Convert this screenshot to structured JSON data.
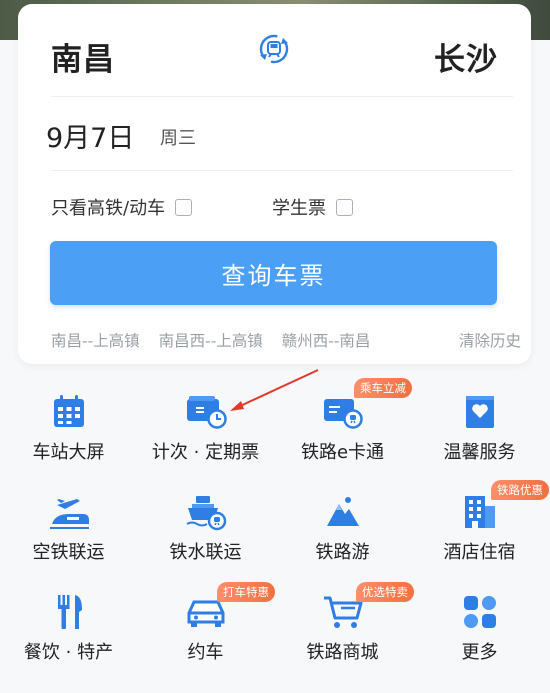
{
  "trip": {
    "from_city": "南昌",
    "to_city": "长沙",
    "date": "9月7日",
    "weekday": "周三"
  },
  "options": {
    "gaotie_label": "只看高铁/动车",
    "gaotie_checked": false,
    "student_label": "学生票",
    "student_checked": false
  },
  "search_button": {
    "label": "查询车票"
  },
  "history": {
    "items": [
      "南昌--上高镇",
      "南昌西--上高镇",
      "赣州西--南昌"
    ],
    "clear_label": "清除历史"
  },
  "services": [
    {
      "label": "车站大屏",
      "icon": "station-screen-icon",
      "badge": ""
    },
    {
      "label": "计次 · 定期票",
      "icon": "period-ticket-icon",
      "badge": ""
    },
    {
      "label": "铁路e卡通",
      "icon": "e-card-icon",
      "badge": "乘车立减"
    },
    {
      "label": "温馨服务",
      "icon": "heart-service-icon",
      "badge": ""
    },
    {
      "label": "空铁联运",
      "icon": "air-rail-icon",
      "badge": ""
    },
    {
      "label": "铁水联运",
      "icon": "rail-water-icon",
      "badge": ""
    },
    {
      "label": "铁路游",
      "icon": "rail-tour-icon",
      "badge": ""
    },
    {
      "label": "酒店住宿",
      "icon": "hotel-icon",
      "badge": "铁路优惠"
    },
    {
      "label": "餐饮 · 特产",
      "icon": "food-icon",
      "badge": ""
    },
    {
      "label": "约车",
      "icon": "car-icon",
      "badge": "打车特惠"
    },
    {
      "label": "铁路商城",
      "icon": "cart-icon",
      "badge": "优选特卖"
    },
    {
      "label": "更多",
      "icon": "more-icon",
      "badge": ""
    }
  ],
  "colors": {
    "accent_blue": "#4ba0f5",
    "icon_blue": "#2f7ee6",
    "badge_orange": "#f2703f",
    "annotation_red": "#e03a2f"
  }
}
